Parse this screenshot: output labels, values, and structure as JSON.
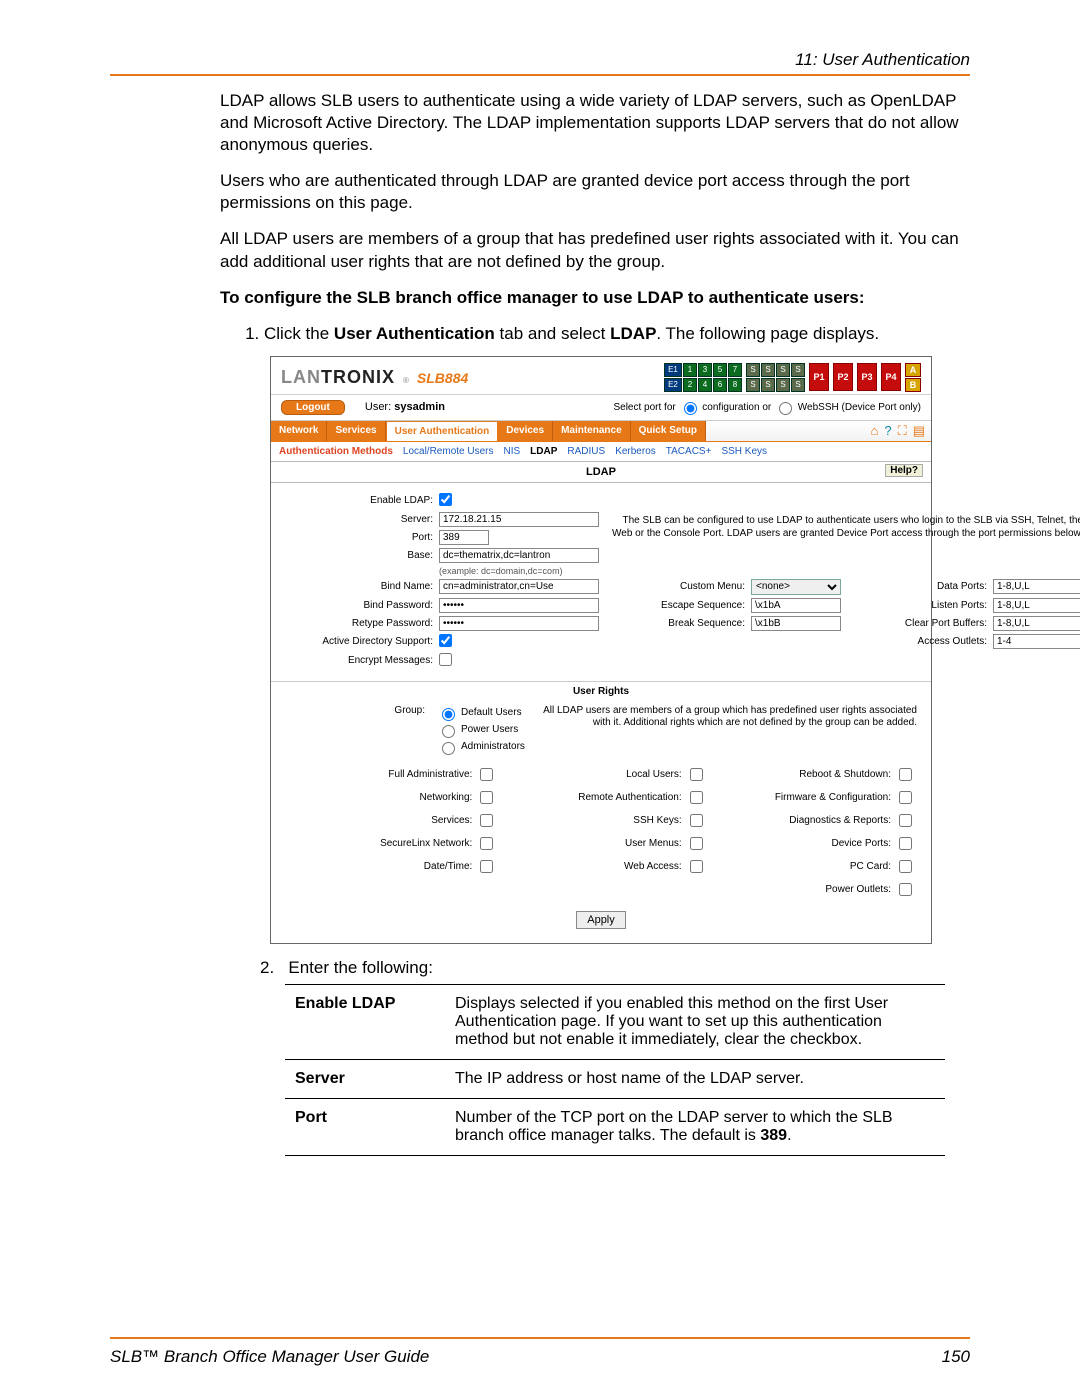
{
  "header": {
    "breadcrumb": "11: User Authentication"
  },
  "paragraphs": {
    "p1": "LDAP allows SLB users to authenticate using a wide variety of LDAP servers, such as OpenLDAP and Microsoft Active Directory. The LDAP implementation supports LDAP servers that do not allow anonymous queries.",
    "p2": "Users who are authenticated through LDAP are granted device port access through the port permissions on this page.",
    "p3": "All LDAP users are members of a group that has predefined user rights associated with it. You can add additional user rights that are not defined by the group.",
    "h1": "To configure the SLB branch office manager to use LDAP to authenticate users:",
    "step1_a": "Click the ",
    "step1_b": "User Authentication",
    "step1_c": " tab and select ",
    "step1_d": "LDAP",
    "step1_e": ". The following page displays.",
    "step2": "Enter the following:"
  },
  "app": {
    "logo_gray": "LAN",
    "logo_black": "TRONIX",
    "reg": "®",
    "model": "SLB884",
    "e1": "E1",
    "e2": "E2",
    "ports": [
      "1",
      "2",
      "3",
      "4",
      "5",
      "6",
      "7",
      "8"
    ],
    "s_ports": [
      "S",
      "S",
      "S",
      "S",
      "S",
      "S",
      "S",
      "S"
    ],
    "p_labels": [
      "P1",
      "P2",
      "P3",
      "P4"
    ],
    "ab": [
      "A",
      "B"
    ],
    "logout": "Logout",
    "user_label": "User:",
    "user_value": "sysadmin",
    "select_port": "Select port for",
    "opt_config": "configuration or",
    "opt_webssh": "WebSSH (Device Port only)"
  },
  "tabs": {
    "main": [
      "Network",
      "Services",
      "User Authentication",
      "Devices",
      "Maintenance",
      "Quick Setup"
    ],
    "active_index": 2,
    "sub": [
      "Authentication Methods",
      "Local/Remote Users",
      "NIS",
      "LDAP",
      "RADIUS",
      "Kerberos",
      "TACACS+",
      "SSH Keys"
    ],
    "sub_active_index": 3,
    "icons": [
      "home",
      "help",
      "expand",
      "list"
    ]
  },
  "section": {
    "title": "LDAP",
    "help": "Help?"
  },
  "form": {
    "enable_ldap": "Enable LDAP:",
    "server": "Server:",
    "server_val": "172.18.21.15",
    "port": "Port:",
    "port_val": "389",
    "base": "Base:",
    "base_val": "dc=thematrix,dc=lantron",
    "base_hint": "(example: dc=domain,dc=com)",
    "bind_name": "Bind Name:",
    "bind_name_val": "cn=administrator,cn=Use",
    "bind_pw": "Bind Password:",
    "bind_pw_val": "••••••",
    "retype_pw": "Retype Password:",
    "retype_pw_val": "••••••",
    "ads": "Active Directory Support:",
    "encrypt": "Encrypt Messages:",
    "custom_menu": "Custom Menu:",
    "custom_menu_val": "<none>",
    "escape": "Escape Sequence:",
    "escape_val": "\\x1bA",
    "break": "Break Sequence:",
    "break_val": "\\x1bB",
    "data_ports": "Data Ports:",
    "data_ports_val": "1-8,U,L",
    "listen_ports": "Listen Ports:",
    "listen_ports_val": "1-8,U,L",
    "clear_port": "Clear Port Buffers:",
    "clear_port_val": "1-8,U,L",
    "access_outlets": "Access Outlets:",
    "access_outlets_val": "1-4",
    "info": "The SLB can be configured to use LDAP to authenticate users who login to the SLB via SSH, Telnet, the Web or the Console Port. LDAP users are granted Device Port access through the port permissions below."
  },
  "user_rights": {
    "title": "User Rights",
    "group_label": "Group:",
    "groups": [
      "Default Users",
      "Power Users",
      "Administrators"
    ],
    "info": "All LDAP users are members of a group which has predefined user rights associated with it. Additional rights which are not defined by the group can be added.",
    "col1": [
      "Full Administrative:",
      "Networking:",
      "Services:",
      "SecureLinx Network:",
      "Date/Time:"
    ],
    "col2": [
      "Local Users:",
      "Remote Authentication:",
      "SSH Keys:",
      "User Menus:",
      "Web Access:"
    ],
    "col3": [
      "Reboot & Shutdown:",
      "Firmware & Configuration:",
      "Diagnostics & Reports:",
      "Device Ports:",
      "PC Card:",
      "Power Outlets:"
    ],
    "apply": "Apply"
  },
  "desc": {
    "r1_name": "Enable LDAP",
    "r1_text": "Displays selected if you enabled this method on the first User Authentication page. If you want to set up this authentication method but not enable it immediately, clear the checkbox.",
    "r2_name": "Server",
    "r2_text": "The IP address or host name of the LDAP server.",
    "r3_name": "Port",
    "r3_text_a": "Number of the TCP port on the LDAP server to which the SLB branch office manager talks. The default is ",
    "r3_text_b": "389",
    "r3_text_c": "."
  },
  "footer": {
    "title": "SLB™ Branch Office Manager User Guide",
    "page": "150"
  }
}
